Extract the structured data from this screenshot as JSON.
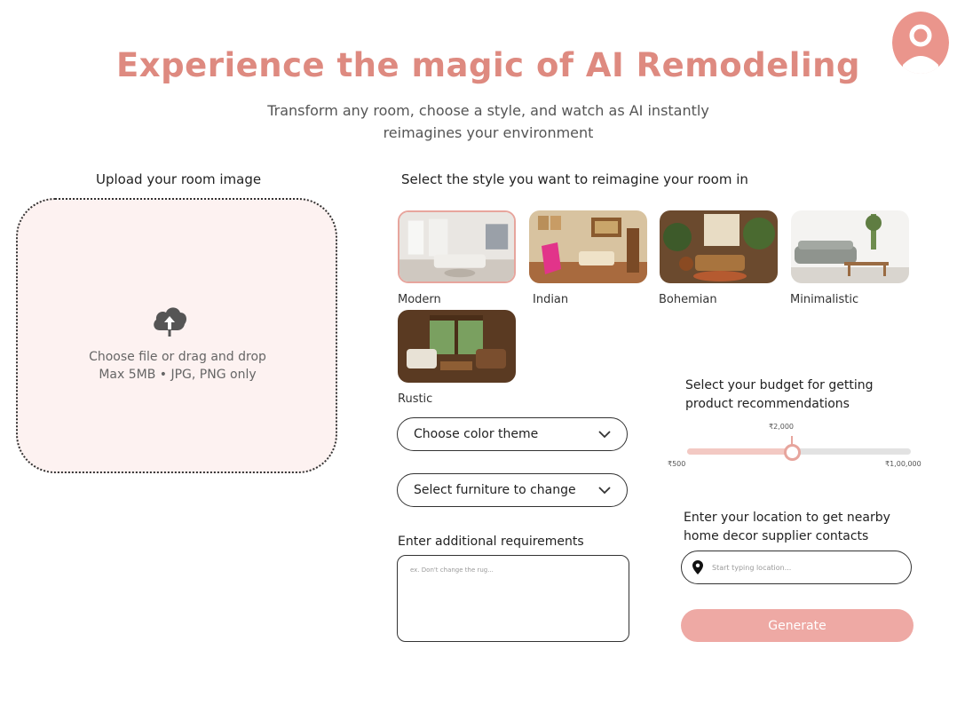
{
  "header": {
    "title": "Experience the magic of AI Remodeling",
    "subtitle": "Transform any room, choose a style, and watch as AI instantly reimagines your environment"
  },
  "upload": {
    "label": "Upload your room image",
    "dropzone_text": "Choose file or drag and drop Max 5MB • JPG, PNG only",
    "icon": "cloud-upload-icon"
  },
  "styles": {
    "label": "Select the style you want to reimagine your room in",
    "items": [
      {
        "label": "Modern",
        "selected": true
      },
      {
        "label": "Indian",
        "selected": false
      },
      {
        "label": "Bohemian",
        "selected": false
      },
      {
        "label": "Minimalistic",
        "selected": false
      },
      {
        "label": "Rustic",
        "selected": false
      }
    ]
  },
  "color_theme": {
    "placeholder": "Choose color theme"
  },
  "furniture": {
    "placeholder": "Select furniture to change"
  },
  "requirements": {
    "label": "Enter additional requirements",
    "placeholder": "ex. Don't change the rug..."
  },
  "budget": {
    "label": "Select your budget for getting product recommendations",
    "current": "₹2,000",
    "min": "₹500",
    "max": "₹1,00,000",
    "fraction": 0.47
  },
  "location": {
    "label": "Enter your location to get nearby home decor supplier contacts",
    "placeholder": "Start typing location..."
  },
  "generate": {
    "label": "Generate"
  },
  "colors": {
    "accent": "#e7a59d",
    "title": "#de8a80",
    "button": "#eea9a4",
    "dropzone_bg": "#fdf2f1"
  }
}
